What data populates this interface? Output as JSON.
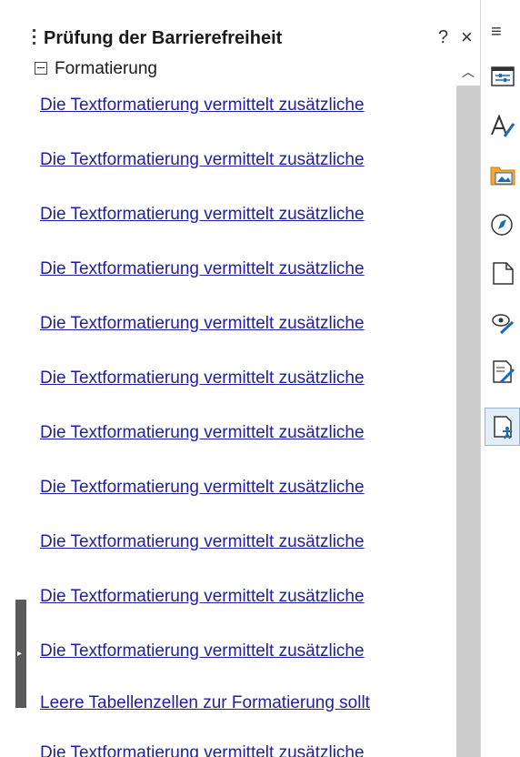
{
  "panel": {
    "title": "Prüfung der Barrierefreiheit",
    "help_label": "?",
    "close_label": "×",
    "group_label": "Formatierung",
    "items": [
      {
        "text": "Die Textformatierung vermittelt zusätzliche"
      },
      {
        "text": "Die Textformatierung vermittelt zusätzliche"
      },
      {
        "text": "Die Textformatierung vermittelt zusätzliche"
      },
      {
        "text": "Die Textformatierung vermittelt zusätzliche"
      },
      {
        "text": "Die Textformatierung vermittelt zusätzliche"
      },
      {
        "text": "Die Textformatierung vermittelt zusätzliche"
      },
      {
        "text": "Die Textformatierung vermittelt zusätzliche"
      },
      {
        "text": "Die Textformatierung vermittelt zusätzliche"
      },
      {
        "text": "Die Textformatierung vermittelt zusätzliche"
      },
      {
        "text": "Die Textformatierung vermittelt zusätzliche"
      },
      {
        "text": "Die Textformatierung vermittelt zusätzliche"
      },
      {
        "text": "Leere Tabellenzellen zur Formatierung sollt"
      },
      {
        "text": "Die Textformatierung vermittelt zusätzliche"
      }
    ]
  },
  "deck": {
    "menu_label": "≡",
    "tabs": [
      {
        "icon": "properties-icon"
      },
      {
        "icon": "styles-icon"
      },
      {
        "icon": "gallery-icon"
      },
      {
        "icon": "navigator-icon"
      },
      {
        "icon": "page-icon"
      },
      {
        "icon": "style-inspector-icon"
      },
      {
        "icon": "manage-changes-icon"
      },
      {
        "icon": "accessibility-check-icon",
        "active": true
      }
    ]
  },
  "colors": {
    "link": "#1e1ea0",
    "active_tab": "#e4eef8",
    "scrollbar": "#cdcdcd"
  }
}
